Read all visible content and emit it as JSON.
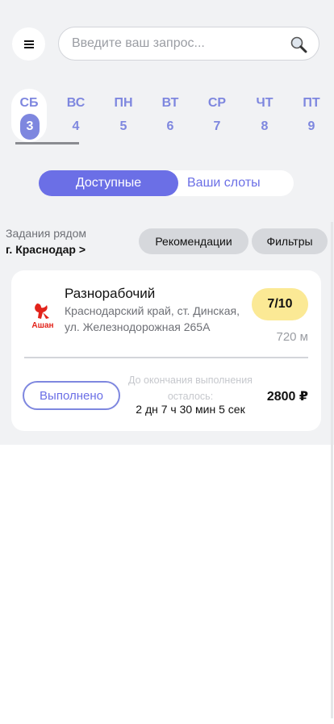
{
  "header": {
    "menu_icon": "hamburger-icon",
    "search": {
      "placeholder": "Введите ваш запрос...",
      "icon": "search-icon"
    }
  },
  "days": [
    {
      "dow": "СБ",
      "num": "3",
      "active": true
    },
    {
      "dow": "ВС",
      "num": "4"
    },
    {
      "dow": "ПН",
      "num": "5"
    },
    {
      "dow": "ВТ",
      "num": "6"
    },
    {
      "dow": "СР",
      "num": "7"
    },
    {
      "dow": "ЧТ",
      "num": "8"
    },
    {
      "dow": "ПТ",
      "num": "9"
    }
  ],
  "tabs": {
    "available": "Доступные",
    "my_slots": "Ваши слоты"
  },
  "location": {
    "nearby_label": "Задания рядом",
    "city": "г. Краснодар >"
  },
  "chips": {
    "recommendations": "Рекомендации",
    "filters": "Фильтры"
  },
  "task": {
    "logo_text": "Ашан",
    "title": "Разнорабочий",
    "address": "Краснодарский край, ст. Динская, ул. Железнодорожная 265А",
    "slots": "7/10",
    "distance": "720 м",
    "done_label": "Выполнено",
    "remaining_label": "До окончания выполнения осталось:",
    "remaining_time": "2 дн 7 ч 30 мин 5 сек",
    "price": "2800 ₽"
  },
  "colors": {
    "accent": "#6b6fe6",
    "day_accent": "#7e87df",
    "badge": "#fbe995",
    "background": "#f1f2f4"
  }
}
